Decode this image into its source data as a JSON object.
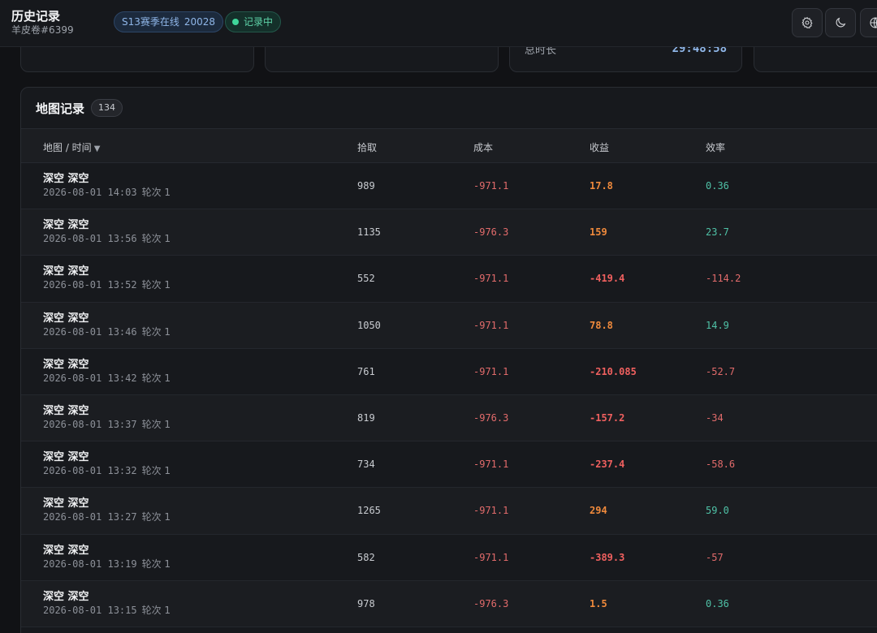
{
  "header": {
    "title": "历史记录",
    "subtitle": "羊皮卷#6399",
    "season_label": "S13赛季在线",
    "season_count": "20028",
    "recording_label": "记录中"
  },
  "stats": [
    {
      "label": "",
      "value": ""
    },
    {
      "label": "",
      "value": ""
    },
    {
      "label": "总时长",
      "value": "29:48:58"
    },
    {
      "label": "",
      "value": ""
    }
  ],
  "records": {
    "title": "地图记录",
    "count": "134",
    "columns": [
      "地图 / 时间",
      "拾取",
      "成本",
      "收益",
      "效率"
    ],
    "rows": [
      {
        "map": "深空 深空",
        "time": "2026-08-01 14:03",
        "round": "轮次 1",
        "pick": "989",
        "cost": "-971.1",
        "gain": "17.8",
        "eff": "0.36"
      },
      {
        "map": "深空 深空",
        "time": "2026-08-01 13:56",
        "round": "轮次 1",
        "pick": "1135",
        "cost": "-976.3",
        "gain": "159",
        "eff": "23.7"
      },
      {
        "map": "深空 深空",
        "time": "2026-08-01 13:52",
        "round": "轮次 1",
        "pick": "552",
        "cost": "-971.1",
        "gain": "-419.4",
        "eff": "-114.2"
      },
      {
        "map": "深空 深空",
        "time": "2026-08-01 13:46",
        "round": "轮次 1",
        "pick": "1050",
        "cost": "-971.1",
        "gain": "78.8",
        "eff": "14.9"
      },
      {
        "map": "深空 深空",
        "time": "2026-08-01 13:42",
        "round": "轮次 1",
        "pick": "761",
        "cost": "-971.1",
        "gain": "-210.085",
        "eff": "-52.7"
      },
      {
        "map": "深空 深空",
        "time": "2026-08-01 13:37",
        "round": "轮次 1",
        "pick": "819",
        "cost": "-976.3",
        "gain": "-157.2",
        "eff": "-34"
      },
      {
        "map": "深空 深空",
        "time": "2026-08-01 13:32",
        "round": "轮次 1",
        "pick": "734",
        "cost": "-971.1",
        "gain": "-237.4",
        "eff": "-58.6"
      },
      {
        "map": "深空 深空",
        "time": "2026-08-01 13:27",
        "round": "轮次 1",
        "pick": "1265",
        "cost": "-971.1",
        "gain": "294",
        "eff": "59.0"
      },
      {
        "map": "深空 深空",
        "time": "2026-08-01 13:19",
        "round": "轮次 1",
        "pick": "582",
        "cost": "-971.1",
        "gain": "-389.3",
        "eff": "-57"
      },
      {
        "map": "深空 深空",
        "time": "2026-08-01 13:15",
        "round": "轮次 1",
        "pick": "978",
        "cost": "-976.3",
        "gain": "1.5",
        "eff": "0.36"
      }
    ]
  },
  "icons": {
    "settings": "gear-icon",
    "theme": "moon-icon",
    "language": "globe-icon"
  }
}
